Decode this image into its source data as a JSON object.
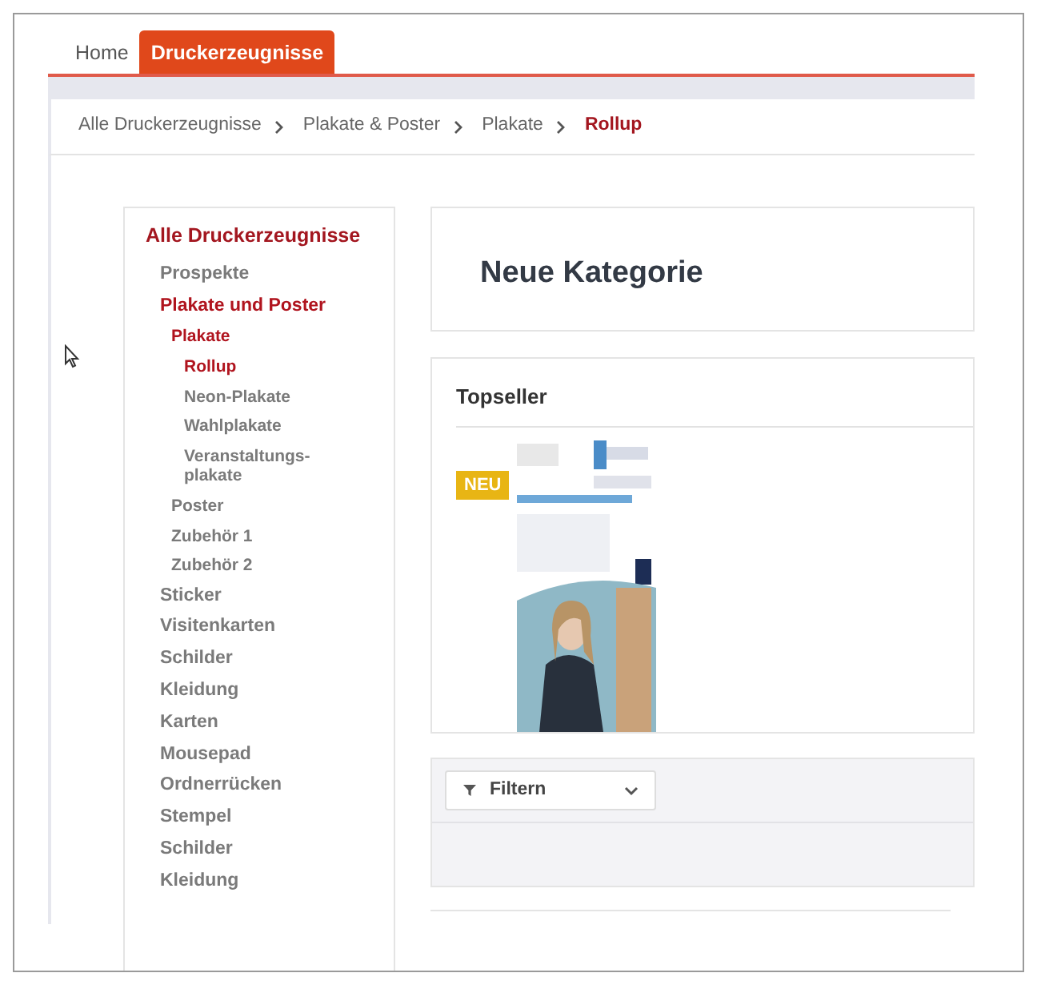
{
  "tabs": [
    {
      "label": "Home",
      "selected": false
    },
    {
      "label": "Druckerzeugnisse",
      "selected": true
    }
  ],
  "breadcrumb": [
    {
      "label": "Alle Druckerzeugnisse",
      "current": false
    },
    {
      "label": "Plakate & Poster",
      "current": false
    },
    {
      "label": "Plakate",
      "current": false
    },
    {
      "label": "Rollup",
      "current": true
    }
  ],
  "sidebar": {
    "title": "Alle Druckerzeugnisse",
    "items": [
      {
        "label": "Prospekte",
        "active": false
      },
      {
        "label": "Plakate und Poster",
        "active": true,
        "children": [
          {
            "label": "Plakate",
            "active": true,
            "children": [
              {
                "label": "Rollup",
                "active": true
              },
              {
                "label": "Neon-Plakate",
                "active": false
              },
              {
                "label": "Wahlplakate",
                "active": false
              },
              {
                "label": "Veranstaltungs-plakate",
                "active": false
              }
            ]
          },
          {
            "label": "Poster",
            "active": false
          },
          {
            "label": "Zubehör 1",
            "active": false
          },
          {
            "label": "Zubehör 2",
            "active": false
          }
        ]
      },
      {
        "label": "Sticker",
        "active": false
      },
      {
        "label": "Visitenkarten",
        "active": false
      },
      {
        "label": "Schilder",
        "active": false
      },
      {
        "label": "Kleidung",
        "active": false
      },
      {
        "label": "Karten",
        "active": false
      },
      {
        "label": "Mousepad",
        "active": false
      },
      {
        "label": "Ordnerrücken",
        "active": false
      },
      {
        "label": "Stempel",
        "active": false
      },
      {
        "label": "Schilder",
        "active": false
      },
      {
        "label": "Kleidung",
        "active": false
      }
    ]
  },
  "category": {
    "title": "Neue Kategorie"
  },
  "topseller": {
    "title": "Topseller",
    "products": [
      {
        "kind": "picture",
        "badge": "NEU"
      }
    ]
  },
  "filter": {
    "label": "Filtern"
  }
}
